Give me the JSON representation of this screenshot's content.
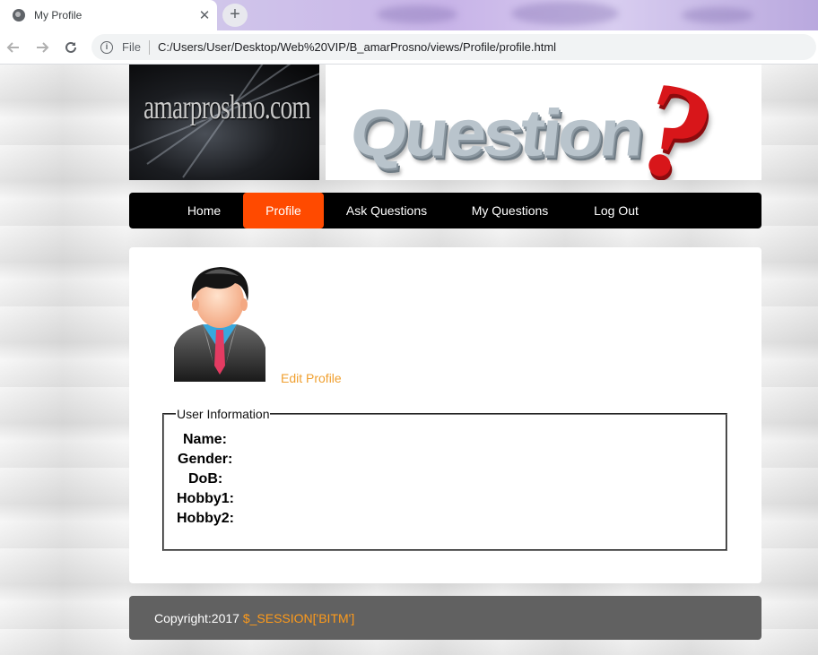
{
  "browser": {
    "tab_title": "My Profile",
    "tab_close": "✕",
    "new_tab": "+",
    "scheme_label": "File",
    "url": "C:/Users/User/Desktop/Web%20VIP/B_amarProsno/views/Profile/profile.html"
  },
  "header": {
    "logo_text": "amarproshno.com",
    "banner_text": "Question",
    "banner_mark": "?"
  },
  "nav": {
    "items": [
      {
        "label": "Home"
      },
      {
        "label": "Profile"
      },
      {
        "label": "Ask Questions"
      },
      {
        "label": "My Questions"
      },
      {
        "label": "Log Out"
      }
    ],
    "active": "Profile",
    "accent_color": "#ff4a00"
  },
  "profile": {
    "edit_link": "Edit Profile",
    "legend": "User Information",
    "fields": {
      "name": "Name:",
      "gender": "Gender:",
      "dob": "DoB:",
      "hobby1": "Hobby1:",
      "hobby2": "Hobby2:"
    },
    "link_color": "#f0a030"
  },
  "footer": {
    "copyright": "Copyright:2017 ",
    "session": "$_SESSION['BITM']",
    "session_color": "#ff9b1a"
  }
}
